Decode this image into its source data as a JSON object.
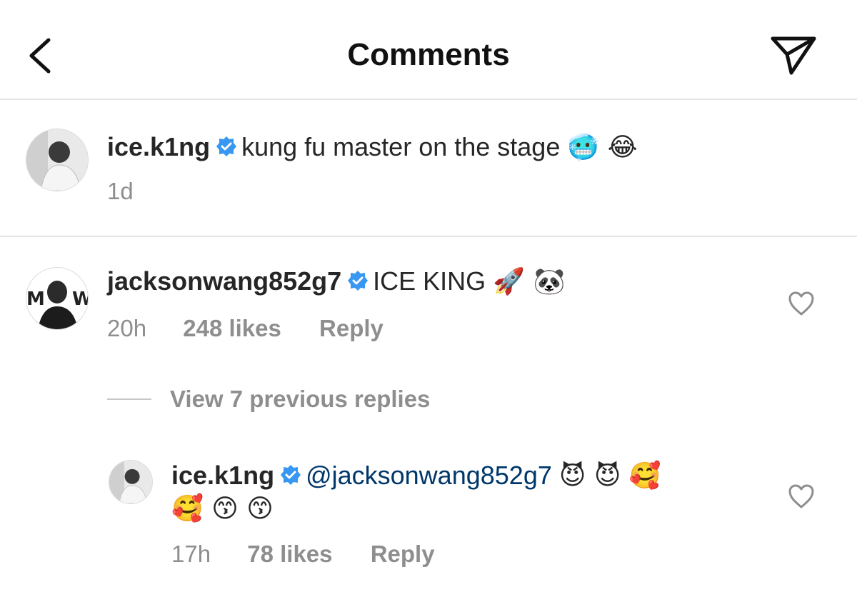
{
  "header": {
    "title": "Comments",
    "back_icon": "chevron-left-icon",
    "send_icon": "direct-send-icon"
  },
  "caption": {
    "username": "ice.k1ng",
    "text": "kung fu master on the stage",
    "emojis": "🥶 😂",
    "time": "1d"
  },
  "comments": [
    {
      "username": "jacksonwang852g7",
      "text": "ICE KING",
      "emojis": "🚀 🐼",
      "time": "20h",
      "likes": "248 likes",
      "reply_label": "Reply",
      "view_replies": "View 7 previous replies",
      "replies": [
        {
          "username": "ice.k1ng",
          "mention": "@jacksonwang852g7",
          "emojis_line1": "😈 😈 🥰",
          "emojis_line2": "🥰 😙 😙",
          "time": "17h",
          "likes": "78 likes",
          "reply_label": "Reply"
        }
      ]
    }
  ],
  "colors": {
    "verified_badge": "#3897f0",
    "mention": "#00376b",
    "meta_text": "#8e8e8e",
    "divider": "#e4e4e4"
  }
}
